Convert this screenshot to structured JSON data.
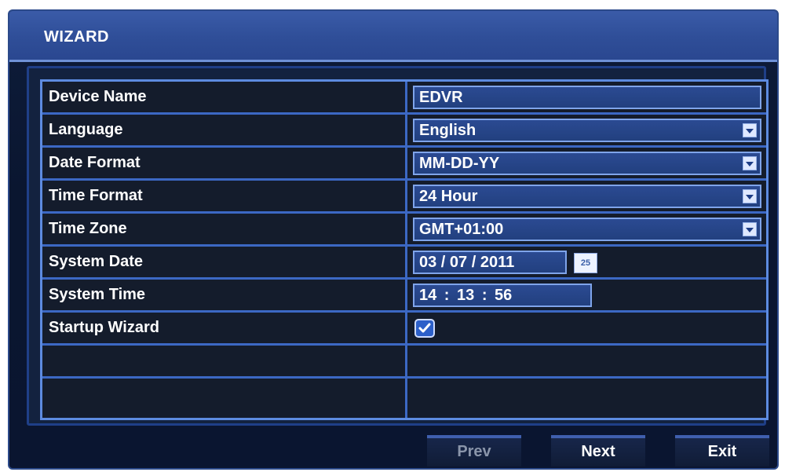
{
  "window": {
    "title": "WIZARD"
  },
  "rows": [
    {
      "label": "Device Name",
      "type": "text",
      "value": "EDVR"
    },
    {
      "label": "Language",
      "type": "select",
      "value": "English"
    },
    {
      "label": "Date Format",
      "type": "select",
      "value": "MM-DD-YY"
    },
    {
      "label": "Time Format",
      "type": "select",
      "value": "24 Hour"
    },
    {
      "label": "Time Zone",
      "type": "select",
      "value": "GMT+01:00"
    },
    {
      "label": "System Date",
      "type": "date",
      "value": "03 / 07 / 2011",
      "calendar_label": "25"
    },
    {
      "label": "System Time",
      "type": "time",
      "value": "14 : 13 : 56"
    },
    {
      "label": "Startup Wizard",
      "type": "checkbox",
      "checked": true
    },
    {
      "label": "",
      "type": "empty"
    },
    {
      "label": "",
      "type": "empty"
    }
  ],
  "buttons": {
    "prev": "Prev",
    "next": "Next",
    "exit": "Exit"
  },
  "colors": {
    "title_bar": "#2f4e98",
    "panel_border": "#5d8be0",
    "field_bg": "#22407f",
    "checkbox_bg": "#2c5fc9"
  },
  "icons": {
    "dropdown": "chevron-down-icon",
    "calendar": "calendar-icon",
    "checkbox": "checkmark-icon"
  }
}
